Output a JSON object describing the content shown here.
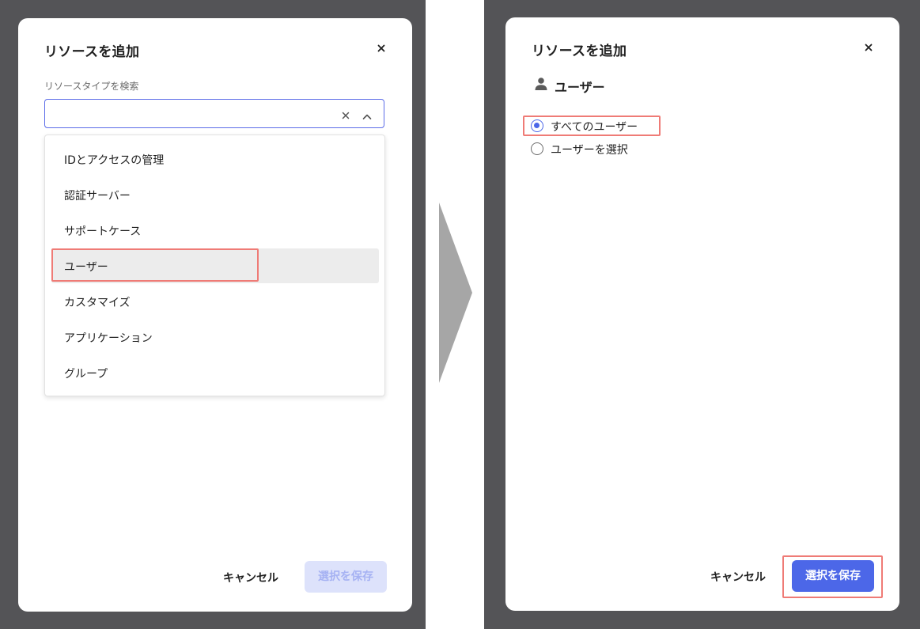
{
  "left_dialog": {
    "title": "リソースを追加",
    "search_label": "リソースタイプを検索",
    "search_value": "",
    "options": [
      {
        "label": "IDとアクセスの管理"
      },
      {
        "label": "認証サーバー"
      },
      {
        "label": "サポートケース"
      },
      {
        "label": "ユーザー",
        "highlighted": true
      },
      {
        "label": "カスタマイズ"
      },
      {
        "label": "アプリケーション"
      },
      {
        "label": "グループ"
      }
    ],
    "cancel_label": "キャンセル",
    "save_label": "選択を保存",
    "save_disabled": true
  },
  "right_dialog": {
    "title": "リソースを追加",
    "resource_type": "ユーザー",
    "resource_icon": "person-icon",
    "radio_options": [
      {
        "label": "すべてのユーザー",
        "selected": true
      },
      {
        "label": "ユーザーを選択",
        "selected": false
      }
    ],
    "cancel_label": "キャンセル",
    "save_label": "選択を保存",
    "save_disabled": false
  },
  "colors": {
    "backdrop": "#545457",
    "accent": "#4c67e8",
    "highlight_outline": "#ef7b76",
    "disabled_button": "#dde2fb"
  }
}
